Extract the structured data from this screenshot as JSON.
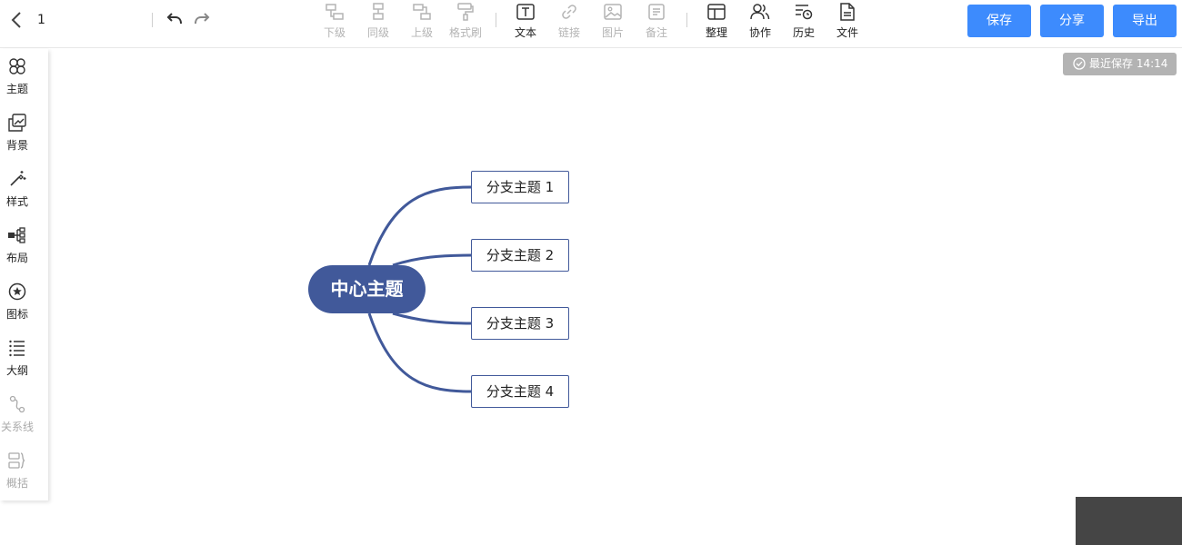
{
  "header": {
    "doc_title": "1",
    "back_icon": "chevron-left-icon",
    "undo_icon": "undo-icon",
    "redo_icon": "redo-icon"
  },
  "toolbar": {
    "child": "下级",
    "sibling": "同级",
    "parent": "上级",
    "format_painter": "格式刷",
    "text": "文本",
    "link": "链接",
    "image": "图片",
    "note": "备注",
    "arrange": "整理",
    "collab": "协作",
    "history": "历史",
    "file": "文件"
  },
  "actions": {
    "save": "保存",
    "share": "分享",
    "export": "导出"
  },
  "status": {
    "last_saved": "最近保存 14:14"
  },
  "sidebar": {
    "theme": "主题",
    "background": "背景",
    "style": "样式",
    "layout": "布局",
    "icon": "图标",
    "outline": "大纲",
    "relation": "关系线",
    "summary": "概括"
  },
  "mindmap": {
    "center": "中心主题",
    "branches": [
      "分支主题 1",
      "分支主题 2",
      "分支主题 3",
      "分支主题 4"
    ]
  },
  "colors": {
    "accent_button": "#3d8bfd",
    "node_fill": "#41599a",
    "edge": "#41599a",
    "disabled_text": "#b4b4b4"
  }
}
